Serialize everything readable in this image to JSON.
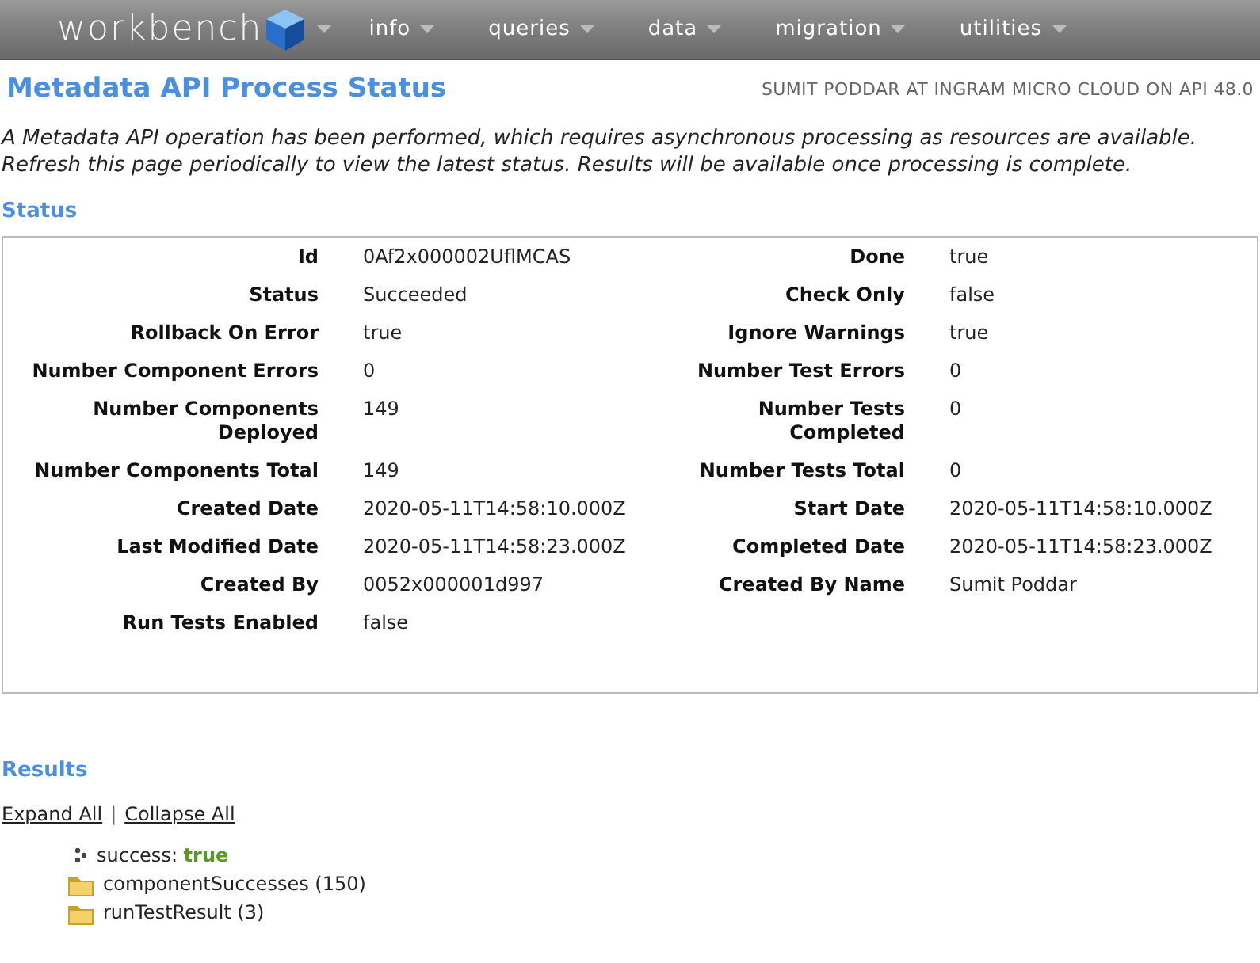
{
  "navbar": {
    "logo": "workbench",
    "menus": [
      {
        "label": "info"
      },
      {
        "label": "queries"
      },
      {
        "label": "data"
      },
      {
        "label": "migration"
      },
      {
        "label": "utilities"
      }
    ]
  },
  "page": {
    "title": "Metadata API Process Status",
    "user": "SUMIT PODDAR AT INGRAM MICRO CLOUD ON API 48.0"
  },
  "intro": "A Metadata API operation has been performed, which requires asynchronous processing as resources are available. Refresh this page periodically to view the latest status. Results will be available once processing is complete.",
  "status": {
    "heading": "Status",
    "rows": [
      {
        "left": {
          "label": "Id",
          "value": "0Af2x000002UflMCAS"
        },
        "right": {
          "label": "Done",
          "value": "true"
        }
      },
      {
        "left": {
          "label": "Status",
          "value": "Succeeded"
        },
        "right": {
          "label": "Check Only",
          "value": "false"
        }
      },
      {
        "left": {
          "label": "Rollback On Error",
          "value": "true"
        },
        "right": {
          "label": "Ignore Warnings",
          "value": "true"
        }
      },
      {
        "left": {
          "label": "Number Component Errors",
          "value": "0"
        },
        "right": {
          "label": "Number Test Errors",
          "value": "0"
        }
      },
      {
        "left": {
          "label": "Number Components Deployed",
          "value": "149"
        },
        "right": {
          "label": "Number Tests Completed",
          "value": "0"
        }
      },
      {
        "left": {
          "label": "Number Components Total",
          "value": "149"
        },
        "right": {
          "label": "Number Tests Total",
          "value": "0"
        }
      },
      {
        "left": {
          "label": "Created Date",
          "value": "2020-05-11T14:58:10.000Z"
        },
        "right": {
          "label": "Start Date",
          "value": "2020-05-11T14:58:10.000Z"
        }
      },
      {
        "left": {
          "label": "Last Modified Date",
          "value": "2020-05-11T14:58:23.000Z"
        },
        "right": {
          "label": "Completed Date",
          "value": "2020-05-11T14:58:23.000Z"
        }
      },
      {
        "left": {
          "label": "Created By",
          "value": "0052x000001d997"
        },
        "right": {
          "label": "Created By Name",
          "value": "Sumit Poddar"
        }
      },
      {
        "left": {
          "label": "Run Tests Enabled",
          "value": "false"
        }
      }
    ]
  },
  "results": {
    "heading": "Results",
    "expand_all": "Expand All",
    "separator": "|",
    "collapse_all": "Collapse All",
    "tree": [
      {
        "kind": "leaf",
        "key": "success:",
        "value": "true"
      },
      {
        "kind": "folder",
        "label": "componentSuccesses (150)"
      },
      {
        "kind": "folder",
        "label": "runTestResult (3)"
      }
    ]
  }
}
